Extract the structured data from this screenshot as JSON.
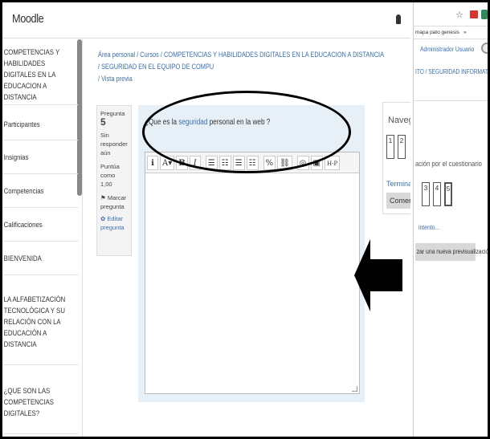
{
  "app": {
    "title": "Moodle"
  },
  "sidebar": {
    "items": [
      {
        "label": "Competencias y habilidades digitales en la educacion a distancia"
      },
      {
        "label": "Participantes"
      },
      {
        "label": "Insignias"
      },
      {
        "label": "Competencias"
      },
      {
        "label": "Calificaciones"
      },
      {
        "label": "BIENVENIDA"
      },
      {
        "label": "LA ALFABETIZACIÓN TECNOLÓGICA Y SU RELACIÓN CON LA EDUCACIÓN A DISTANCIA"
      },
      {
        "label": "¿QUE SON LAS COMPETENCIAS DIGITALES?"
      }
    ]
  },
  "breadcrumb": {
    "line1": "Área personal / Cursos / COMPETENCIAS Y HABILIDADES DIGITALES EN LA EDUCACION A DISTANCIA / SEGURIDAD EN EL EQUIPO DE COMPU",
    "line2": "/ Vista previa"
  },
  "question_info": {
    "label": "Pregunta",
    "number": "5",
    "status": "Sin responder aún",
    "score": "Puntúa como 1,00",
    "flag_icon": "flag-icon",
    "flag": "Marcar pregunta",
    "edit": "Editar pregunta"
  },
  "question": {
    "prefix": "¿Que es la",
    "highlight": "seguridad",
    "suffix": "personal en la web ?"
  },
  "editor": {
    "toolbar": [
      "ℹ",
      "A▾",
      "B",
      "I",
      "☰",
      "☷",
      "☰",
      "☷",
      "%",
      "⛓",
      "◎",
      "▣",
      "H-P"
    ]
  },
  "quiz_nav": {
    "title": "Navegación por el cuestionario",
    "buttons": [
      "1",
      "2",
      "3",
      "4",
      "5"
    ],
    "finish": "Terminar intento...",
    "restart": "Comenzar una nueva previsualización"
  },
  "right_window": {
    "bookmark1": "mapa pato genesis",
    "bookmark2": "»",
    "user": "Administrador Usuario",
    "crumb": "ITO / SEGURIDAD INFORMATICA",
    "nav_title": "ación por el cuestionario",
    "finish": "intento...",
    "restart": "zar una nueva previsualización"
  }
}
